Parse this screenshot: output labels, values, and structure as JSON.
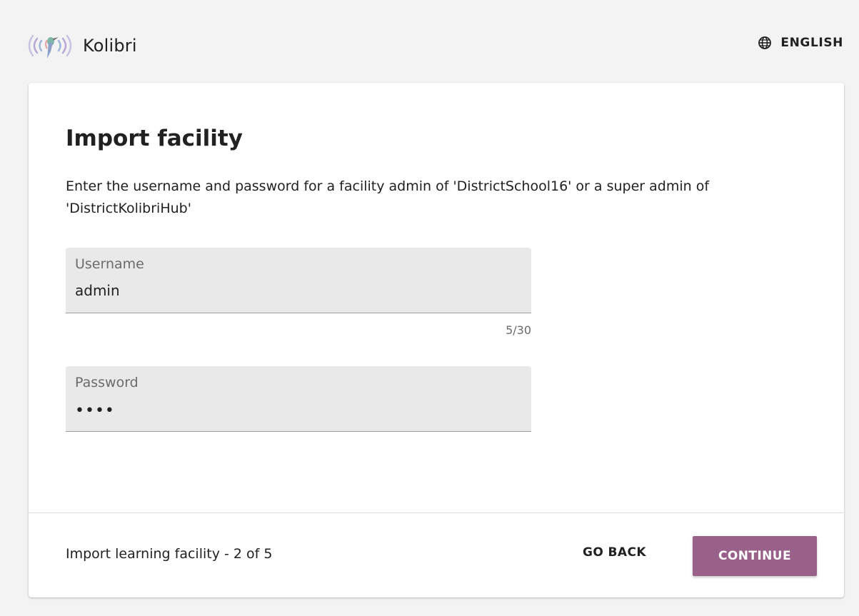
{
  "header": {
    "app_name": "Kolibri",
    "language_label": "ENGLISH"
  },
  "card": {
    "title": "Import facility",
    "description": "Enter the username and password for a facility admin of 'DistrictSchool16' or a super admin of 'DistrictKolibriHub'",
    "username": {
      "label": "Username",
      "value": "admin",
      "counter": "5/30"
    },
    "password": {
      "label": "Password",
      "masked_value": "••••"
    },
    "footer": {
      "step_text": "Import learning facility - 2 of 5",
      "go_back_label": "GO BACK",
      "continue_label": "CONTINUE"
    }
  },
  "colors": {
    "background": "#f3f3f3",
    "card": "#ffffff",
    "field": "#e9e9e9",
    "primary_button": "#996189",
    "text": "#212121",
    "muted_text": "#6b6b6b"
  }
}
